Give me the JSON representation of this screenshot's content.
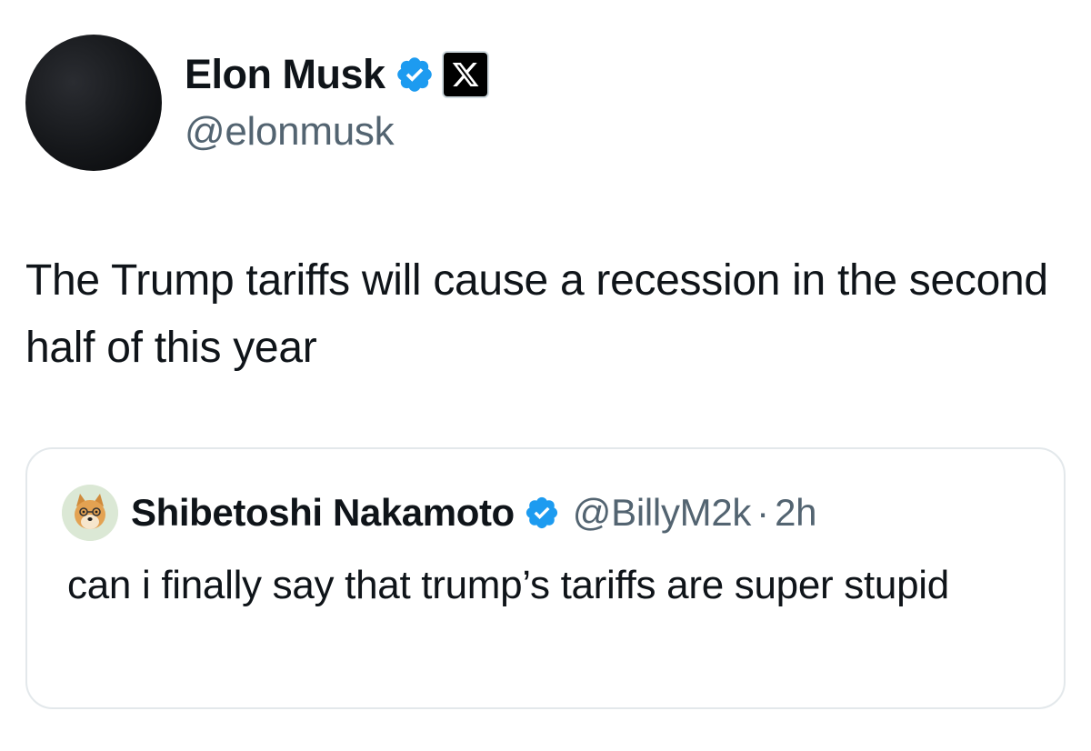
{
  "tweet": {
    "author": {
      "display_name": "Elon Musk",
      "handle": "@elonmusk",
      "verified": true,
      "verified_color": "#1d9bf0",
      "affiliation_badge": "x-logo-icon"
    },
    "text": "The Trump tariffs will cause a recession in the second half of this year",
    "quoted_tweet": {
      "author": {
        "display_name": "Shibetoshi Nakamoto",
        "handle": "@BillyM2k",
        "verified": true,
        "avatar": "shiba-inu-avatar"
      },
      "separator": "·",
      "time": "2h",
      "text": "can i finally say that trump’s tariffs are super stupid"
    }
  },
  "colors": {
    "text_primary": "#0f1419",
    "text_secondary": "#536471",
    "border": "#e3e8eb",
    "verified_blue": "#1d9bf0"
  }
}
